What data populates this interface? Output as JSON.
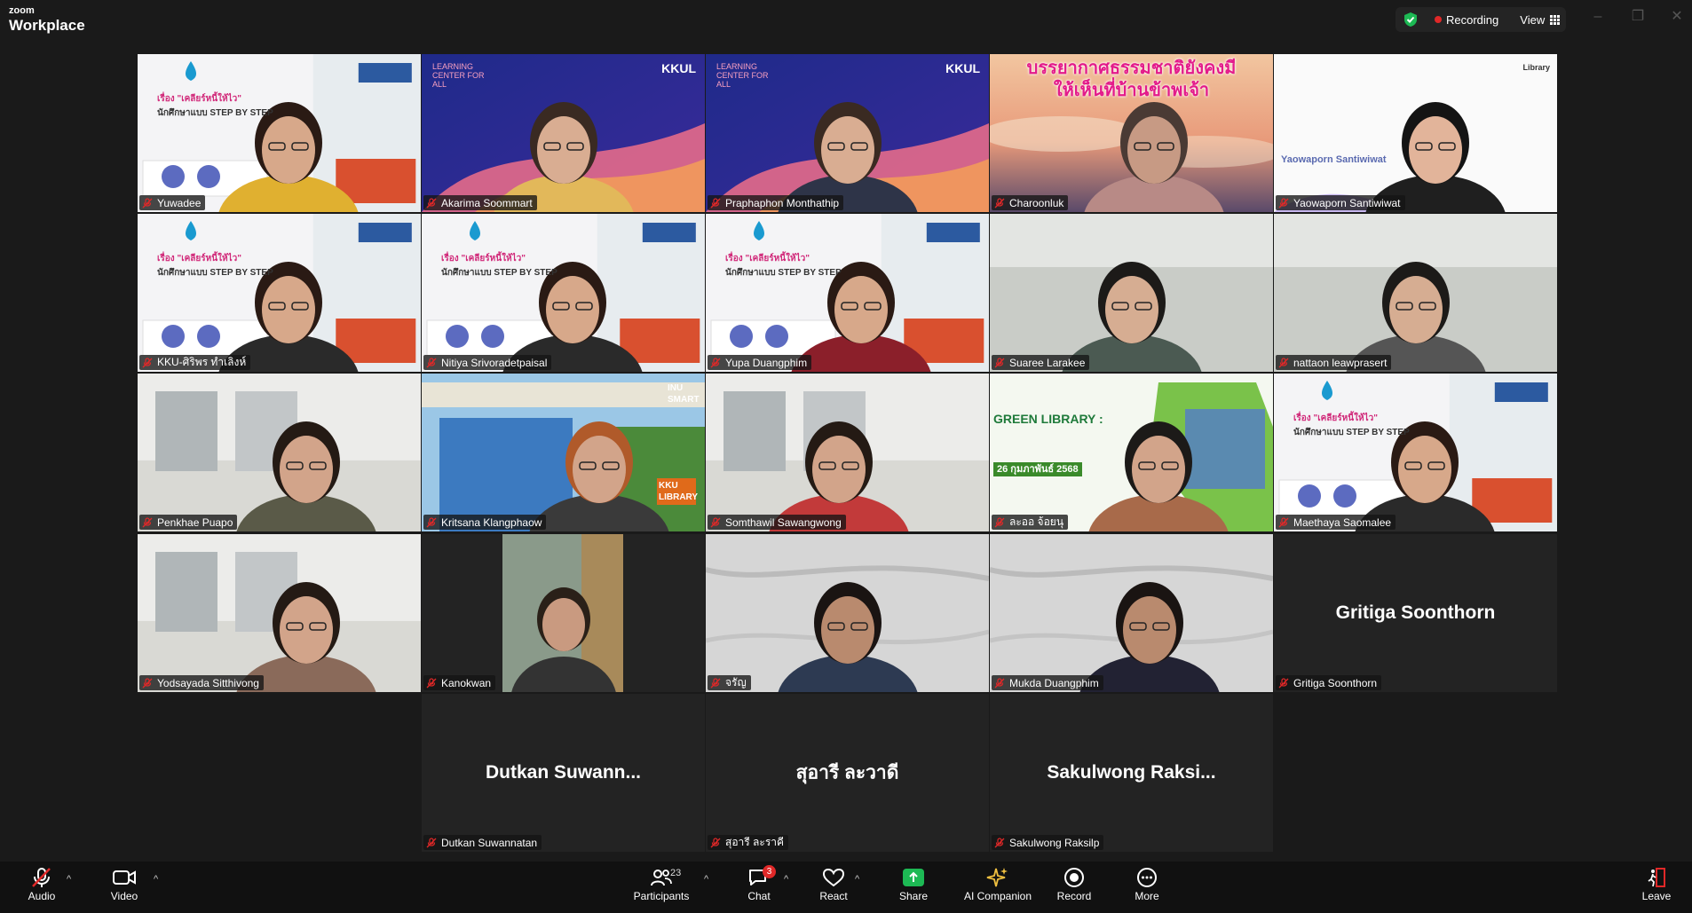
{
  "app": {
    "brand_top": "zoom",
    "brand_bottom": "Workplace"
  },
  "status": {
    "recording_label": "Recording",
    "view_label": "View"
  },
  "tiles": [
    {
      "name": "Yuwadee",
      "kind": "slide"
    },
    {
      "name": "Akarima Soommart",
      "kind": "brand"
    },
    {
      "name": "Praphaphon Monthathip",
      "kind": "brand"
    },
    {
      "name": "Charoonluk",
      "kind": "sunset"
    },
    {
      "name": "Yaowaporn Santiwiwat",
      "kind": "white"
    },
    {
      "name": "KKU-ศิริพร ทำเลิงห์",
      "kind": "slide"
    },
    {
      "name": "Nitiya Srivoradetpaisal",
      "kind": "slide"
    },
    {
      "name": "Yupa Duangphim",
      "kind": "slide",
      "active": true
    },
    {
      "name": "Suaree Larakee",
      "kind": "room"
    },
    {
      "name": "nattaon leawprasert",
      "kind": "room"
    },
    {
      "name": "Penkhae Puapo",
      "kind": "office"
    },
    {
      "name": "Kritsana Klangphaow",
      "kind": "building"
    },
    {
      "name": "Somthawil Sawangwong",
      "kind": "office"
    },
    {
      "name": "ละออ จ้อยนุ",
      "kind": "green"
    },
    {
      "name": "Maethaya Saomalee",
      "kind": "slide"
    },
    {
      "name": "Yodsayada Sitthivong",
      "kind": "office"
    },
    {
      "name": "Kanokwan",
      "kind": "narrow"
    },
    {
      "name": "จรัญ",
      "kind": "marble"
    },
    {
      "name": "Mukda Duangphim",
      "kind": "marble"
    },
    {
      "name": "Gritiga Soonthorn",
      "kind": "nocam",
      "display_name": "Gritiga Soonthorn"
    },
    {
      "name": "Dutkan Suwannatan",
      "kind": "nocam",
      "display_name": "Dutkan  Suwann..."
    },
    {
      "name": "สุอารี ละราคี",
      "kind": "nocam",
      "display_name": "สุอารี ละวาดี"
    },
    {
      "name": "Sakulwong Raksilp",
      "kind": "nocam",
      "display_name": "Sakulwong  Raksi..."
    }
  ],
  "overlays": {
    "charoonluk_banner_l1": "บรรยากาศธรรมชาติยังคงมี",
    "charoonluk_banner_l2": "ให้เห็นที่บ้านข้าพเจ้า",
    "kkul_logo": "KKUL",
    "learning_center": "LEARNING CENTER FOR ALL",
    "green_library_title": "GREEN LIBRARY :",
    "green_library_date": "26 กุมภาพันธ์ 2568",
    "inu_smart": "INU SMART",
    "kku_library": "KKU LIBRARY",
    "slide_heading": "เรื่อง \"เคลียร์หนี้ให้ไว\"",
    "slide_sub": "นักศึกษาแบบ STEP BY STEP",
    "yaowaporn_caption": "Yaowaporn Santiwiwat",
    "library_brand": "Library"
  },
  "toolbar": {
    "audio": "Audio",
    "video": "Video",
    "participants": "Participants",
    "participants_count": "23",
    "chat": "Chat",
    "chat_badge": "3",
    "react": "React",
    "share": "Share",
    "ai_companion": "AI Companion",
    "record": "Record",
    "more": "More",
    "leave": "Leave"
  },
  "colors": {
    "active_outline": "#30d07a",
    "recording": "#e02828",
    "mic_off": "#e02828",
    "share": "#1db954",
    "shield": "#1db954"
  }
}
